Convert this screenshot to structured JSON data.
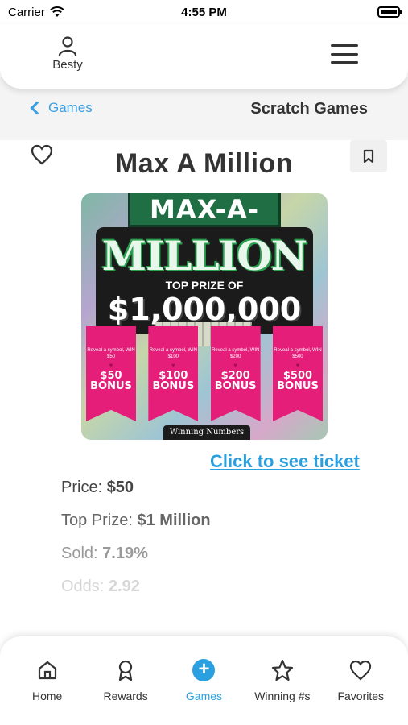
{
  "status_bar": {
    "carrier": "Carrier",
    "time": "4:55 PM"
  },
  "header": {
    "profile_name": "Besty",
    "menu_icon": "hamburger-menu-icon"
  },
  "sub_nav": {
    "back_label": "Games",
    "title": "Scratch Games"
  },
  "game": {
    "title": "Max A Million",
    "see_ticket_label": "Click to see ticket",
    "ticket_art": {
      "banner": "MAX-A-",
      "name": "MILLION",
      "top_prize_caption": "TOP PRIZE OF",
      "top_prize_amount": "$1,000,000",
      "bonus_caption": "Reveal a symbol, WIN",
      "bonuses": [
        "$50\nBONUS",
        "$100\nBONUS",
        "$200\nBONUS",
        "$500\nBONUS"
      ],
      "bonus_small": [
        "Reveal a symbol, WIN $50",
        "Reveal a symbol, WIN $100",
        "Reveal a symbol, WIN $200",
        "Reveal a symbol, WIN $500"
      ],
      "footer": "Winning Numbers"
    },
    "details": [
      {
        "label": "Price: ",
        "value": "$50"
      },
      {
        "label": "Top Prize: ",
        "value": "$1 Million"
      },
      {
        "label": "Sold: ",
        "value": "7.19%"
      },
      {
        "label": "Odds: ",
        "value": "2.92"
      }
    ]
  },
  "tabs": [
    {
      "label": "Home",
      "icon": "home-icon"
    },
    {
      "label": "Rewards",
      "icon": "rewards-medal-icon"
    },
    {
      "label": "Games",
      "icon": "plus-circle-icon",
      "active": true
    },
    {
      "label": "Winning #s",
      "icon": "star-icon"
    },
    {
      "label": "Favorites",
      "icon": "heart-icon"
    }
  ],
  "colors": {
    "accent": "#2aa0e0",
    "text": "#333333",
    "ticket_pink": "#e51e7a",
    "ticket_green": "#1f6e44"
  }
}
